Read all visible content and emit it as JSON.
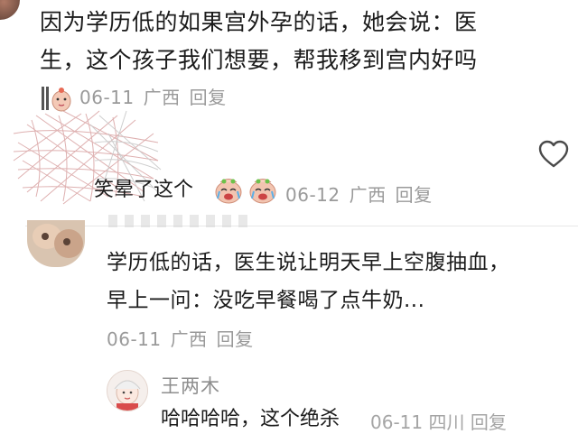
{
  "comment1": {
    "text_line1": "因为学历低的如果宫外孕的话，她会说：医",
    "text_line2": "生，这个孩子我们想要，帮我移到宫内好吗",
    "date": "06-11",
    "location": "广西",
    "reply_label": "回复",
    "sticker_icon": "bear-sticker-icon"
  },
  "reply1": {
    "text": "笑晕了这个",
    "emojis": "crying-laughing-face-icon",
    "date": "06-12",
    "location": "广西",
    "reply_label": "回复"
  },
  "like": {
    "icon": "heart-outline-icon"
  },
  "comment2": {
    "text_line1": "学历低的话，医生说让明天早上空腹抽血，",
    "text_line2": "早上一问：没吃早餐喝了点牛奶...",
    "date": "06-11",
    "location": "广西",
    "reply_label": "回复"
  },
  "nested_reply": {
    "username": "王两木",
    "text": "哈哈哈哈，这个绝杀",
    "meta": "06-11 四川 回复"
  }
}
